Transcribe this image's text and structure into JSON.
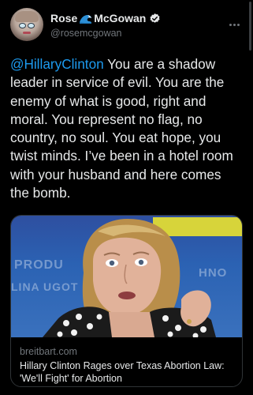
{
  "tweet": {
    "author": {
      "display_name_first": "Rose",
      "display_name_last": "McGowan",
      "handle": "@rosemcgowan",
      "verified": true
    },
    "mention": "@HillaryClinton",
    "body": " You are a shadow leader in service of evil. You are the enemy of what is good, right and moral. You represent no flag, no country, no soul. You eat hope, you twist minds. I’ve been in a hotel room with your husband and here comes the bomb."
  },
  "card": {
    "domain": "breitbart.com",
    "title": "Hillary Clinton Rages over Texas Abortion Law: 'We'll Fight' for Abortion"
  },
  "icons": {
    "wave": "wave-emoji-icon",
    "verified": "verified-badge-icon",
    "more": "more-options-icon"
  },
  "colors": {
    "background": "#000000",
    "text": "#e7e9ea",
    "secondary": "#71767b",
    "accent": "#1d9bf0",
    "border": "#2f3336"
  }
}
